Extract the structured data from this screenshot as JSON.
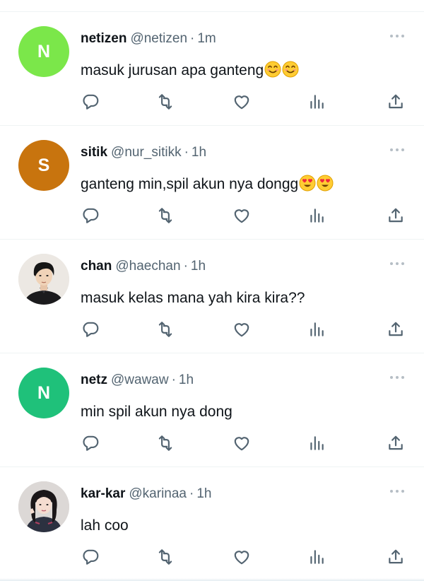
{
  "tweets": [
    {
      "avatar": {
        "type": "letter",
        "letter": "N",
        "color": "#7be74a"
      },
      "name": "netizen",
      "handle": "@netizen",
      "separator": "·",
      "time": "1m",
      "text": "masuk jurusan apa ganteng",
      "emojis": [
        "smiling-face-emoji",
        "smiling-face-emoji"
      ]
    },
    {
      "avatar": {
        "type": "letter",
        "letter": "S",
        "color": "#c8740e"
      },
      "name": "sitik",
      "handle": "@nur_sitikk",
      "separator": "·",
      "time": "1h",
      "text": "ganteng min,spil akun nya dongg",
      "emojis": [
        "heart-eyes-emoji",
        "heart-eyes-emoji"
      ]
    },
    {
      "avatar": {
        "type": "photo",
        "icon": "user-photo-chan"
      },
      "name": "chan",
      "handle": "@haechan",
      "separator": "·",
      "time": "1h",
      "text": "masuk kelas mana yah kira kira??",
      "emojis": []
    },
    {
      "avatar": {
        "type": "letter",
        "letter": "N",
        "color": "#1fc17a"
      },
      "name": "netz",
      "handle": "@wawaw",
      "separator": "·",
      "time": "1h",
      "text": "min spil akun nya dong",
      "emojis": []
    },
    {
      "avatar": {
        "type": "photo",
        "icon": "user-photo-karina"
      },
      "name": "kar-kar",
      "handle": "@karinaa",
      "separator": "·",
      "time": "1h",
      "text": "lah coo",
      "emojis": []
    }
  ],
  "colors": {
    "muted": "#536471",
    "icon": "#536471",
    "divider": "#eff3f4"
  },
  "action_icons": [
    "reply-icon",
    "retweet-icon",
    "like-icon",
    "views-icon",
    "share-icon"
  ]
}
